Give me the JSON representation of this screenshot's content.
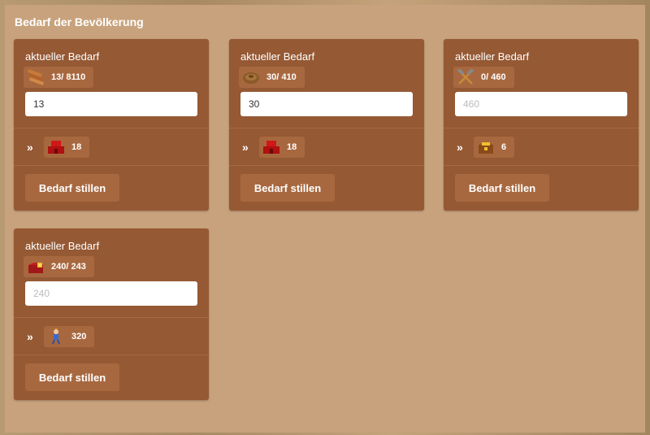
{
  "panel": {
    "title": "Bedarf der Bevölkerung"
  },
  "cards": [
    {
      "heading": "aktueller Bedarf",
      "need": {
        "icon": "planks-icon",
        "text": "13/ 8110"
      },
      "input": {
        "value": "13",
        "placeholder": ""
      },
      "reward": {
        "arrow": "»",
        "icon": "red-building-icon",
        "text": "18"
      },
      "button": "Bedarf stillen"
    },
    {
      "heading": "aktueller Bedarf",
      "need": {
        "icon": "rope-coil-icon",
        "text": "30/ 410"
      },
      "input": {
        "value": "30",
        "placeholder": ""
      },
      "reward": {
        "arrow": "»",
        "icon": "red-building-icon",
        "text": "18"
      },
      "button": "Bedarf stillen"
    },
    {
      "heading": "aktueller Bedarf",
      "need": {
        "icon": "crossed-hammers-icon",
        "text": "0/ 460"
      },
      "input": {
        "value": "",
        "placeholder": "460"
      },
      "reward": {
        "arrow": "»",
        "icon": "treasure-chest-icon",
        "text": "6"
      },
      "button": "Bedarf stillen"
    },
    {
      "heading": "aktueller Bedarf",
      "need": {
        "icon": "treasure-chest-icon",
        "text": "240/ 243"
      },
      "input": {
        "value": "",
        "placeholder": "240"
      },
      "reward": {
        "arrow": "»",
        "icon": "settler-figure-icon",
        "text": "320"
      },
      "button": "Bedarf stillen"
    }
  ]
}
